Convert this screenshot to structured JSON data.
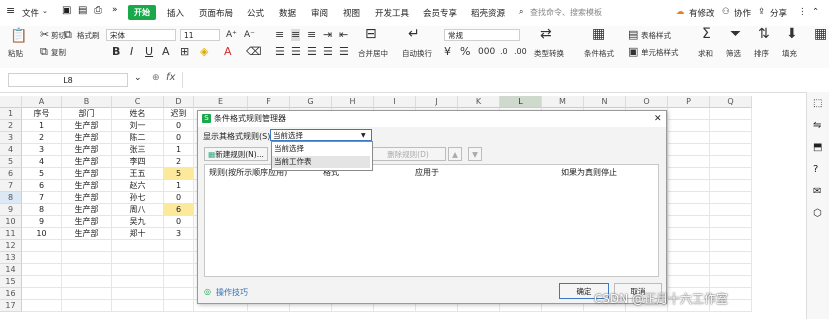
{
  "menu": {
    "file_label": "文件",
    "tabs": [
      "开始",
      "插入",
      "页面布局",
      "公式",
      "数据",
      "审阅",
      "视图",
      "开发工具",
      "会员专享",
      "稻壳资源"
    ],
    "search_placeholder": "查找命令、搜索模板",
    "modified_label": "有修改",
    "collab_label": "协作",
    "share_label": "分享"
  },
  "ribbon": {
    "paste_label": "粘贴",
    "cut_label": "剪切",
    "copy_label": "复制",
    "format_painter_label": "格式刷",
    "font_name": "宋体",
    "font_size": "11",
    "merge_label": "合并居中",
    "wrap_label": "自动换行",
    "number_format": "常规",
    "type_convert_label": "类型转换",
    "cond_format_label": "条件格式",
    "table_style_label": "表格样式",
    "cell_style_label": "单元格样式",
    "sum_label": "求和",
    "filter_label": "筛选",
    "sort_label": "排序",
    "fill_label": "填充"
  },
  "formula_bar": {
    "cell_ref": "L8",
    "fx": "fx"
  },
  "sheet": {
    "columns": [
      "A",
      "B",
      "C",
      "D",
      "E",
      "F",
      "G",
      "H",
      "I",
      "J",
      "K",
      "L",
      "M",
      "N",
      "O",
      "P",
      "Q"
    ],
    "rows": [
      {
        "num": "1",
        "a": "序号",
        "b": "部门",
        "c": "姓名",
        "d": "迟到"
      },
      {
        "num": "2",
        "a": "1",
        "b": "生产部",
        "c": "刘一",
        "d": "0"
      },
      {
        "num": "3",
        "a": "2",
        "b": "生产部",
        "c": "陈二",
        "d": "0"
      },
      {
        "num": "4",
        "a": "3",
        "b": "生产部",
        "c": "张三",
        "d": "1"
      },
      {
        "num": "5",
        "a": "4",
        "b": "生产部",
        "c": "李四",
        "d": "2"
      },
      {
        "num": "6",
        "a": "5",
        "b": "生产部",
        "c": "王五",
        "d": "5"
      },
      {
        "num": "7",
        "a": "6",
        "b": "生产部",
        "c": "赵六",
        "d": "1"
      },
      {
        "num": "8",
        "a": "7",
        "b": "生产部",
        "c": "孙七",
        "d": "0"
      },
      {
        "num": "9",
        "a": "8",
        "b": "生产部",
        "c": "周八",
        "d": "6"
      },
      {
        "num": "10",
        "a": "9",
        "b": "生产部",
        "c": "吴九",
        "d": "0"
      },
      {
        "num": "11",
        "a": "10",
        "b": "生产部",
        "c": "郑十",
        "d": "3"
      },
      {
        "num": "12",
        "a": "",
        "b": "",
        "c": "",
        "d": ""
      },
      {
        "num": "13",
        "a": "",
        "b": "",
        "c": "",
        "d": ""
      },
      {
        "num": "14",
        "a": "",
        "b": "",
        "c": "",
        "d": ""
      },
      {
        "num": "15",
        "a": "",
        "b": "",
        "c": "",
        "d": ""
      },
      {
        "num": "16",
        "a": "",
        "b": "",
        "c": "",
        "d": ""
      },
      {
        "num": "17",
        "a": "",
        "b": "",
        "c": "",
        "d": ""
      }
    ]
  },
  "dialog": {
    "title": "条件格式规则管理器",
    "show_rules_label": "显示其格式规则(S):",
    "show_rules_value": "当前选择",
    "dropdown_options": [
      "当前选择",
      "当前工作表"
    ],
    "new_rule_label": "新建规则(N)...",
    "delete_rule_label": "删除规则(D)",
    "col_rule": "规则(按所示顺序应用)",
    "col_format": "格式",
    "col_applies": "应用于",
    "col_stop": "如果为真则停止",
    "tips_label": "操作技巧",
    "ok_label": "确定",
    "cancel_label": "取消"
  },
  "watermark": "CSDN @正月十六工作室"
}
